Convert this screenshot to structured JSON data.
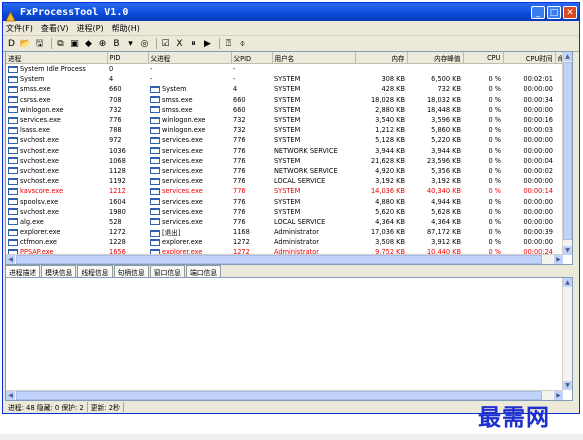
{
  "window": {
    "title": "FxProcessTool V1.0"
  },
  "menu": [
    "文件(F)",
    "查看(V)",
    "进程(P)",
    "帮助(H)"
  ],
  "toolbar": [
    "D",
    "📂",
    "🖫",
    "⧉",
    "▣",
    "◆",
    "⊕",
    "B",
    "▾",
    "◎",
    "☑",
    "X",
    "⏸",
    "▶",
    "⍰",
    "⌽"
  ],
  "columns": [
    "进程",
    "PID",
    "父进程",
    "父PID",
    "用户名",
    "内存",
    "内存峰值",
    "CPU",
    "CPU时间",
    "命"
  ],
  "rows": [
    {
      "name": "System Idle Process",
      "pid": "0",
      "parent": "-",
      "ppid": "-",
      "user": "",
      "mem": "",
      "peak": "",
      "cpu": "",
      "time": "",
      "red": false
    },
    {
      "name": "System",
      "pid": "4",
      "parent": "-",
      "ppid": "-",
      "user": "SYSTEM",
      "mem": "308 KB",
      "peak": "6,500 KB",
      "cpu": "0 %",
      "time": "00:02:01",
      "red": false
    },
    {
      "name": "smss.exe",
      "pid": "660",
      "parent": "System",
      "ppid": "4",
      "user": "SYSTEM",
      "mem": "428 KB",
      "peak": "732 KB",
      "cpu": "0 %",
      "time": "00:00:00",
      "red": false
    },
    {
      "name": "csrss.exe",
      "pid": "708",
      "parent": "smss.exe",
      "ppid": "660",
      "user": "SYSTEM",
      "mem": "18,028 KB",
      "peak": "18,032 KB",
      "cpu": "0 %",
      "time": "00:00:34",
      "red": false
    },
    {
      "name": "winlogon.exe",
      "pid": "732",
      "parent": "smss.exe",
      "ppid": "660",
      "user": "SYSTEM",
      "mem": "2,880 KB",
      "peak": "18,448 KB",
      "cpu": "0 %",
      "time": "00:00:00",
      "red": false
    },
    {
      "name": "services.exe",
      "pid": "776",
      "parent": "winlogon.exe",
      "ppid": "732",
      "user": "SYSTEM",
      "mem": "3,540 KB",
      "peak": "3,596 KB",
      "cpu": "0 %",
      "time": "00:00:16",
      "red": false
    },
    {
      "name": "lsass.exe",
      "pid": "788",
      "parent": "winlogon.exe",
      "ppid": "732",
      "user": "SYSTEM",
      "mem": "1,212 KB",
      "peak": "5,860 KB",
      "cpu": "0 %",
      "time": "00:00:03",
      "red": false
    },
    {
      "name": "svchost.exe",
      "pid": "972",
      "parent": "services.exe",
      "ppid": "776",
      "user": "SYSTEM",
      "mem": "5,128 KB",
      "peak": "5,220 KB",
      "cpu": "0 %",
      "time": "00:00:00",
      "red": false
    },
    {
      "name": "svchost.exe",
      "pid": "1036",
      "parent": "services.exe",
      "ppid": "776",
      "user": "NETWORK SERVICE",
      "mem": "3,944 KB",
      "peak": "3,944 KB",
      "cpu": "0 %",
      "time": "00:00:00",
      "red": false
    },
    {
      "name": "svchost.exe",
      "pid": "1068",
      "parent": "services.exe",
      "ppid": "776",
      "user": "SYSTEM",
      "mem": "21,628 KB",
      "peak": "23,596 KB",
      "cpu": "0 %",
      "time": "00:00:04",
      "red": false
    },
    {
      "name": "svchost.exe",
      "pid": "1128",
      "parent": "services.exe",
      "ppid": "776",
      "user": "NETWORK SERVICE",
      "mem": "4,920 KB",
      "peak": "5,356 KB",
      "cpu": "0 %",
      "time": "00:00:02",
      "red": false
    },
    {
      "name": "svchost.exe",
      "pid": "1192",
      "parent": "services.exe",
      "ppid": "776",
      "user": "LOCAL SERVICE",
      "mem": "3,192 KB",
      "peak": "3,192 KB",
      "cpu": "0 %",
      "time": "00:00:00",
      "red": false
    },
    {
      "name": "kavscore.exe",
      "pid": "1212",
      "parent": "services.exe",
      "ppid": "776",
      "user": "SYSTEM",
      "mem": "14,036 KB",
      "peak": "40,340 KB",
      "cpu": "0 %",
      "time": "00:00:14",
      "red": true
    },
    {
      "name": "spoolsv.exe",
      "pid": "1604",
      "parent": "services.exe",
      "ppid": "776",
      "user": "SYSTEM",
      "mem": "4,880 KB",
      "peak": "4,944 KB",
      "cpu": "0 %",
      "time": "00:00:00",
      "red": false
    },
    {
      "name": "svchost.exe",
      "pid": "1980",
      "parent": "services.exe",
      "ppid": "776",
      "user": "SYSTEM",
      "mem": "5,620 KB",
      "peak": "5,628 KB",
      "cpu": "0 %",
      "time": "00:00:00",
      "red": false
    },
    {
      "name": "alg.exe",
      "pid": "528",
      "parent": "services.exe",
      "ppid": "776",
      "user": "LOCAL SERVICE",
      "mem": "4,364 KB",
      "peak": "4,364 KB",
      "cpu": "0 %",
      "time": "00:00:00",
      "red": false
    },
    {
      "name": "explorer.exe",
      "pid": "1272",
      "parent": "[退出]",
      "ppid": "1168",
      "user": "Administrator",
      "mem": "17,036 KB",
      "peak": "87,172 KB",
      "cpu": "0 %",
      "time": "00:00:39",
      "red": false
    },
    {
      "name": "ctfmon.exe",
      "pid": "1228",
      "parent": "explorer.exe",
      "ppid": "1272",
      "user": "Administrator",
      "mem": "3,508 KB",
      "peak": "3,912 KB",
      "cpu": "0 %",
      "time": "00:00:00",
      "red": false
    },
    {
      "name": "PPSAP.exe",
      "pid": "1656",
      "parent": "explorer.exe",
      "ppid": "1272",
      "user": "Administrator",
      "mem": "9,752 KB",
      "peak": "10,440 KB",
      "cpu": "0 %",
      "time": "00:00:24",
      "red": true
    }
  ],
  "tabs": [
    "进程描述",
    "模块信息",
    "线程信息",
    "句柄信息",
    "窗口信息",
    "端口信息"
  ],
  "status": [
    "进程: 48 隐藏: 0 保护: 2",
    "更新: 2秒"
  ],
  "watermark": "最需网"
}
